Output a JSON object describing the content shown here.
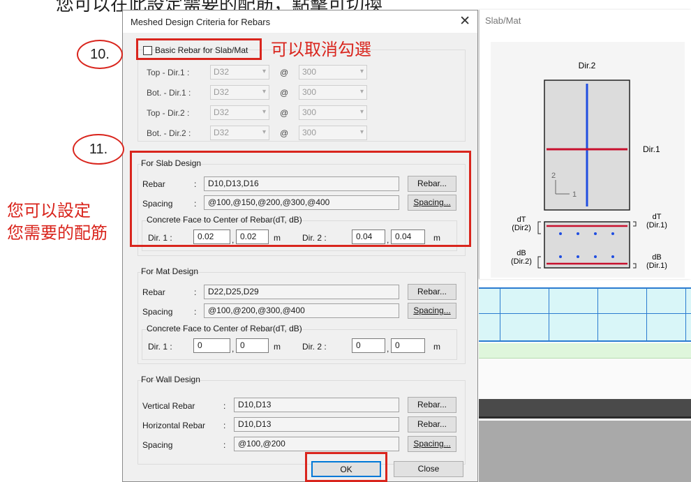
{
  "top_caption": "您可以在此設定需要的配筋，點擊可切換",
  "dialog": {
    "title": "Meshed Design Criteria for Rebars",
    "close_glyph": "✕",
    "basic_rebar": {
      "checkbox_label": "Basic Rebar for Slab/Mat",
      "checked": false,
      "rows": [
        {
          "label": "Top - Dir.1 :",
          "rebar": "D32",
          "at": "@",
          "spacing": "300"
        },
        {
          "label": "Bot. - Dir.1 :",
          "rebar": "D32",
          "at": "@",
          "spacing": "300"
        },
        {
          "label": "Top - Dir.2 :",
          "rebar": "D32",
          "at": "@",
          "spacing": "300"
        },
        {
          "label": "Bot. - Dir.2 :",
          "rebar": "D32",
          "at": "@",
          "spacing": "300"
        }
      ]
    },
    "slab": {
      "group_title": "For Slab Design",
      "rebar_label": "Rebar",
      "rebar_value": "D10,D13,D16",
      "rebar_button": "Rebar...",
      "spacing_label": "Spacing",
      "spacing_value": "@100,@150,@200,@300,@400",
      "spacing_button": "Spacing...",
      "cover_title": "Concrete Face to Center of Rebar(dT, dB)",
      "dir1_label": "Dir. 1 :",
      "dir1_dt": "0.02",
      "dir1_db": "0.02",
      "dir2_label": "Dir. 2 :",
      "dir2_dt": "0.04",
      "dir2_db": "0.04",
      "unit": "m"
    },
    "mat": {
      "group_title": "For Mat Design",
      "rebar_label": "Rebar",
      "rebar_value": "D22,D25,D29",
      "rebar_button": "Rebar...",
      "spacing_label": "Spacing",
      "spacing_value": "@100,@200,@300,@400",
      "spacing_button": "Spacing...",
      "cover_title": "Concrete Face to Center of Rebar(dT, dB)",
      "dir1_label": "Dir. 1 :",
      "dir1_dt": "0",
      "dir1_db": "0",
      "dir2_label": "Dir. 2 :",
      "dir2_dt": "0",
      "dir2_db": "0",
      "unit": "m"
    },
    "wall": {
      "group_title": "For Wall Design",
      "vertical_label": "Vertical Rebar",
      "vertical_value": "D10,D13",
      "vertical_button": "Rebar...",
      "horizontal_label": "Horizontal Rebar",
      "horizontal_value": "D10,D13",
      "horizontal_button": "Rebar...",
      "spacing_label": "Spacing",
      "spacing_value": "@100,@200",
      "spacing_button": "Spacing..."
    },
    "colon": ":",
    "comma": ",",
    "ok_button": "OK",
    "close_button": "Close"
  },
  "preview": {
    "title": "Slab/Mat",
    "dir2": "Dir.2",
    "dir1": "Dir.1",
    "axis_2": "2",
    "axis_1": "1",
    "dt_left": "dT",
    "dt_left_sub": "(Dir2)",
    "dt_right": "dT",
    "dt_right_sub": "(Dir.1)",
    "db_left": "dB",
    "db_left_sub": "(Dir.2)",
    "db_right": "dB",
    "db_right_sub": "(Dir.1)"
  },
  "annotations": {
    "step10": "10.",
    "step10_note": "可以取消勾選",
    "step11": "11.",
    "side_note_line1": "您可以設定",
    "side_note_line2": "您需要的配筋"
  },
  "colors": {
    "annotation_red": "#d9251d",
    "rebar_blue": "#1f4de0",
    "rebar_red": "#c8102e"
  }
}
